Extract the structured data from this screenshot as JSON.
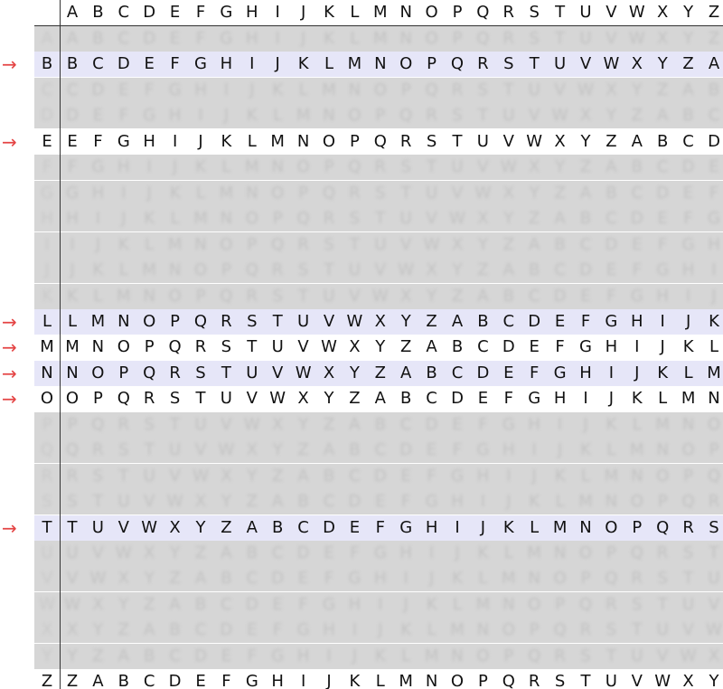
{
  "tabula_recta": {
    "alphabet": [
      "A",
      "B",
      "C",
      "D",
      "E",
      "F",
      "G",
      "H",
      "I",
      "J",
      "K",
      "L",
      "M",
      "N",
      "O",
      "P",
      "Q",
      "R",
      "S",
      "T",
      "U",
      "V",
      "W",
      "X",
      "Y",
      "Z"
    ],
    "header_letters": [
      "A",
      "B",
      "C",
      "D",
      "E",
      "F",
      "G",
      "H",
      "I",
      "J",
      "K",
      "L",
      "M",
      "N",
      "O",
      "P",
      "Q",
      "R",
      "S",
      "T",
      "U",
      "V",
      "W",
      "X",
      "Y",
      "Z"
    ],
    "highlighted_rows": [
      "B",
      "E",
      "L",
      "M",
      "N",
      "O",
      "T",
      "Z"
    ],
    "arrow_rows": [
      "B",
      "E",
      "L",
      "M",
      "N",
      "O",
      "T"
    ],
    "arrow_glyph": "→"
  },
  "colors": {
    "arrow": "#e44444",
    "highlight_band": "#e6e6f8",
    "faded_band": "#d6d6d6",
    "faded_text": "#c2c2c2",
    "grid_line": "#333333"
  }
}
